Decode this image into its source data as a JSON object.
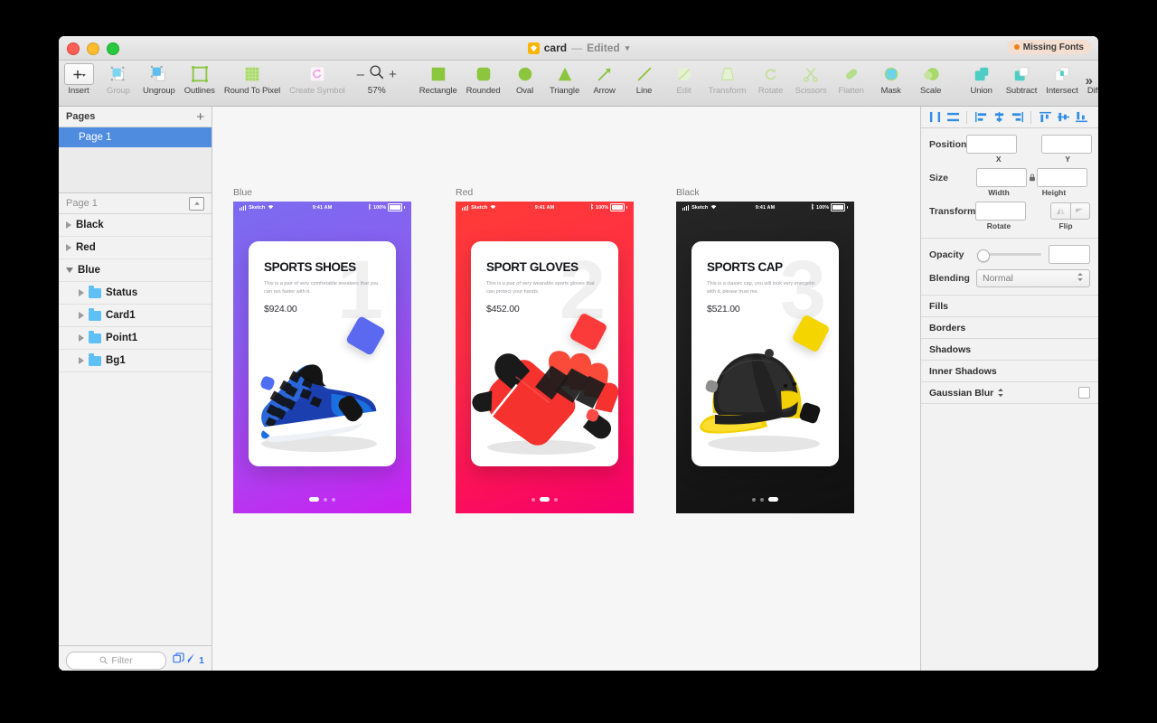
{
  "window": {
    "title": "card",
    "separator": "—",
    "edited": "Edited",
    "missing_fonts": "Missing Fonts",
    "missing_fonts_dot_color": "#f08018"
  },
  "toolbar": {
    "insert": "Insert",
    "group": "Group",
    "ungroup": "Ungroup",
    "outlines": "Outlines",
    "round_to_pixel": "Round To Pixel",
    "create_symbol": "Create Symbol",
    "zoom_minus": "–",
    "zoom_plus": "+",
    "zoom_level": "57%",
    "rectangle": "Rectangle",
    "rounded": "Rounded",
    "oval": "Oval",
    "triangle": "Triangle",
    "arrow": "Arrow",
    "line": "Line",
    "edit": "Edit",
    "transform": "Transform",
    "rotate": "Rotate",
    "scissors": "Scissors",
    "flatten": "Flatten",
    "mask": "Mask",
    "scale": "Scale",
    "union": "Union",
    "subtract": "Subtract",
    "intersect": "Intersect",
    "difference": "Difference",
    "overflow": "»",
    "shape_color": "#8cc63f",
    "boolean_color": "#4ecdc4"
  },
  "sidebar": {
    "pages_header": "Pages",
    "add_page": "+",
    "pages": [
      {
        "label": "Page 1",
        "selected": true
      }
    ],
    "layers_header": "Page 1",
    "layers": [
      {
        "label": "Black",
        "expanded": false,
        "indent": false
      },
      {
        "label": "Red",
        "expanded": false,
        "indent": false
      },
      {
        "label": "Blue",
        "expanded": true,
        "indent": false
      },
      {
        "label": "Status",
        "expanded": false,
        "indent": true
      },
      {
        "label": "Card1",
        "expanded": false,
        "indent": true
      },
      {
        "label": "Point1",
        "expanded": false,
        "indent": true
      },
      {
        "label": "Bg1",
        "expanded": false,
        "indent": true
      }
    ],
    "filter_placeholder": "Filter",
    "count": "1"
  },
  "inspector": {
    "position_label": "Position",
    "position_x": "",
    "position_y": "",
    "x_sub": "X",
    "y_sub": "Y",
    "size_label": "Size",
    "width_value": "",
    "height_value": "",
    "width_sub": "Width",
    "height_sub": "Height",
    "transform_label": "Transform",
    "rotate_value": "",
    "rotate_sub": "Rotate",
    "flip_sub": "Flip",
    "opacity_label": "Opacity",
    "opacity_value": "",
    "blending_label": "Blending",
    "blending_value": "Normal",
    "sections": [
      {
        "label": "Fills",
        "checkbox": false
      },
      {
        "label": "Borders",
        "checkbox": false
      },
      {
        "label": "Shadows",
        "checkbox": false
      },
      {
        "label": "Inner Shadows",
        "checkbox": false
      },
      {
        "label": "Gaussian Blur",
        "checkbox": true,
        "stepper": true
      }
    ],
    "align_accent": "#2f8de4"
  },
  "canvas": {
    "artboards": [
      {
        "name": "Blue",
        "theme": "blue",
        "status": {
          "carrier": "Sketch",
          "time": "9:41 AM",
          "battery": "100%"
        },
        "title": "SPORTS SHOES",
        "desc": "This is a pair of very comfortable sneakers that you can run faster with it.",
        "price": "$924.00",
        "watermark": "1",
        "active_dot": 0,
        "accent": "#5b68f0"
      },
      {
        "name": "Red",
        "theme": "red",
        "status": {
          "carrier": "Sketch",
          "time": "9:41 AM",
          "battery": "100%"
        },
        "title": "SPORT GLOVES",
        "desc": "This is a pair of very wearable sports gloves that can protect your hands.",
        "price": "$452.00",
        "watermark": "2",
        "active_dot": 1,
        "accent": "#fb3b39"
      },
      {
        "name": "Black",
        "theme": "black",
        "status": {
          "carrier": "Sketch",
          "time": "9:41 AM",
          "battery": "100%"
        },
        "title": "SPORTS CAP",
        "desc": "This is a classic cap, you will look very energetic with it, please trust me.",
        "price": "$521.00",
        "watermark": "3",
        "active_dot": 2,
        "accent": "#f5d500"
      }
    ]
  }
}
